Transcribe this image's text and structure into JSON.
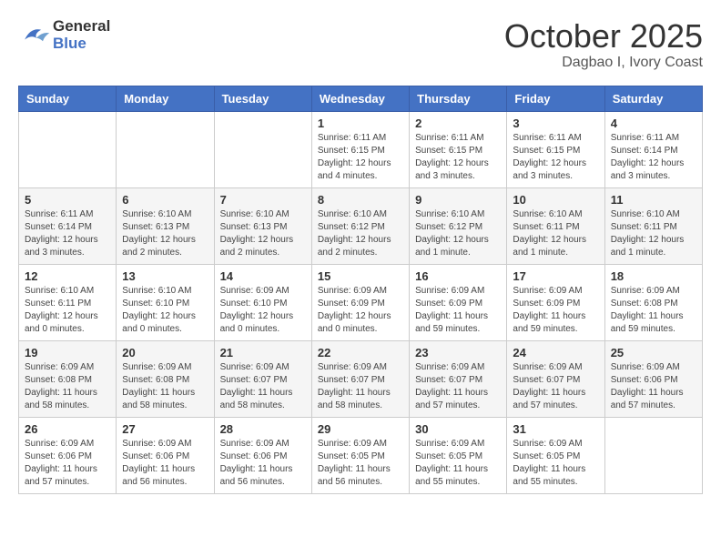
{
  "header": {
    "logo_general": "General",
    "logo_blue": "Blue",
    "month": "October 2025",
    "location": "Dagbao I, Ivory Coast"
  },
  "days_of_week": [
    "Sunday",
    "Monday",
    "Tuesday",
    "Wednesday",
    "Thursday",
    "Friday",
    "Saturday"
  ],
  "weeks": [
    {
      "days": [
        {
          "number": "",
          "info": ""
        },
        {
          "number": "",
          "info": ""
        },
        {
          "number": "",
          "info": ""
        },
        {
          "number": "1",
          "info": "Sunrise: 6:11 AM\nSunset: 6:15 PM\nDaylight: 12 hours and 4 minutes."
        },
        {
          "number": "2",
          "info": "Sunrise: 6:11 AM\nSunset: 6:15 PM\nDaylight: 12 hours and 3 minutes."
        },
        {
          "number": "3",
          "info": "Sunrise: 6:11 AM\nSunset: 6:15 PM\nDaylight: 12 hours and 3 minutes."
        },
        {
          "number": "4",
          "info": "Sunrise: 6:11 AM\nSunset: 6:14 PM\nDaylight: 12 hours and 3 minutes."
        }
      ]
    },
    {
      "days": [
        {
          "number": "5",
          "info": "Sunrise: 6:11 AM\nSunset: 6:14 PM\nDaylight: 12 hours and 3 minutes."
        },
        {
          "number": "6",
          "info": "Sunrise: 6:10 AM\nSunset: 6:13 PM\nDaylight: 12 hours and 2 minutes."
        },
        {
          "number": "7",
          "info": "Sunrise: 6:10 AM\nSunset: 6:13 PM\nDaylight: 12 hours and 2 minutes."
        },
        {
          "number": "8",
          "info": "Sunrise: 6:10 AM\nSunset: 6:12 PM\nDaylight: 12 hours and 2 minutes."
        },
        {
          "number": "9",
          "info": "Sunrise: 6:10 AM\nSunset: 6:12 PM\nDaylight: 12 hours and 1 minute."
        },
        {
          "number": "10",
          "info": "Sunrise: 6:10 AM\nSunset: 6:11 PM\nDaylight: 12 hours and 1 minute."
        },
        {
          "number": "11",
          "info": "Sunrise: 6:10 AM\nSunset: 6:11 PM\nDaylight: 12 hours and 1 minute."
        }
      ]
    },
    {
      "days": [
        {
          "number": "12",
          "info": "Sunrise: 6:10 AM\nSunset: 6:11 PM\nDaylight: 12 hours and 0 minutes."
        },
        {
          "number": "13",
          "info": "Sunrise: 6:10 AM\nSunset: 6:10 PM\nDaylight: 12 hours and 0 minutes."
        },
        {
          "number": "14",
          "info": "Sunrise: 6:09 AM\nSunset: 6:10 PM\nDaylight: 12 hours and 0 minutes."
        },
        {
          "number": "15",
          "info": "Sunrise: 6:09 AM\nSunset: 6:09 PM\nDaylight: 12 hours and 0 minutes."
        },
        {
          "number": "16",
          "info": "Sunrise: 6:09 AM\nSunset: 6:09 PM\nDaylight: 11 hours and 59 minutes."
        },
        {
          "number": "17",
          "info": "Sunrise: 6:09 AM\nSunset: 6:09 PM\nDaylight: 11 hours and 59 minutes."
        },
        {
          "number": "18",
          "info": "Sunrise: 6:09 AM\nSunset: 6:08 PM\nDaylight: 11 hours and 59 minutes."
        }
      ]
    },
    {
      "days": [
        {
          "number": "19",
          "info": "Sunrise: 6:09 AM\nSunset: 6:08 PM\nDaylight: 11 hours and 58 minutes."
        },
        {
          "number": "20",
          "info": "Sunrise: 6:09 AM\nSunset: 6:08 PM\nDaylight: 11 hours and 58 minutes."
        },
        {
          "number": "21",
          "info": "Sunrise: 6:09 AM\nSunset: 6:07 PM\nDaylight: 11 hours and 58 minutes."
        },
        {
          "number": "22",
          "info": "Sunrise: 6:09 AM\nSunset: 6:07 PM\nDaylight: 11 hours and 58 minutes."
        },
        {
          "number": "23",
          "info": "Sunrise: 6:09 AM\nSunset: 6:07 PM\nDaylight: 11 hours and 57 minutes."
        },
        {
          "number": "24",
          "info": "Sunrise: 6:09 AM\nSunset: 6:07 PM\nDaylight: 11 hours and 57 minutes."
        },
        {
          "number": "25",
          "info": "Sunrise: 6:09 AM\nSunset: 6:06 PM\nDaylight: 11 hours and 57 minutes."
        }
      ]
    },
    {
      "days": [
        {
          "number": "26",
          "info": "Sunrise: 6:09 AM\nSunset: 6:06 PM\nDaylight: 11 hours and 57 minutes."
        },
        {
          "number": "27",
          "info": "Sunrise: 6:09 AM\nSunset: 6:06 PM\nDaylight: 11 hours and 56 minutes."
        },
        {
          "number": "28",
          "info": "Sunrise: 6:09 AM\nSunset: 6:06 PM\nDaylight: 11 hours and 56 minutes."
        },
        {
          "number": "29",
          "info": "Sunrise: 6:09 AM\nSunset: 6:05 PM\nDaylight: 11 hours and 56 minutes."
        },
        {
          "number": "30",
          "info": "Sunrise: 6:09 AM\nSunset: 6:05 PM\nDaylight: 11 hours and 55 minutes."
        },
        {
          "number": "31",
          "info": "Sunrise: 6:09 AM\nSunset: 6:05 PM\nDaylight: 11 hours and 55 minutes."
        },
        {
          "number": "",
          "info": ""
        }
      ]
    }
  ]
}
